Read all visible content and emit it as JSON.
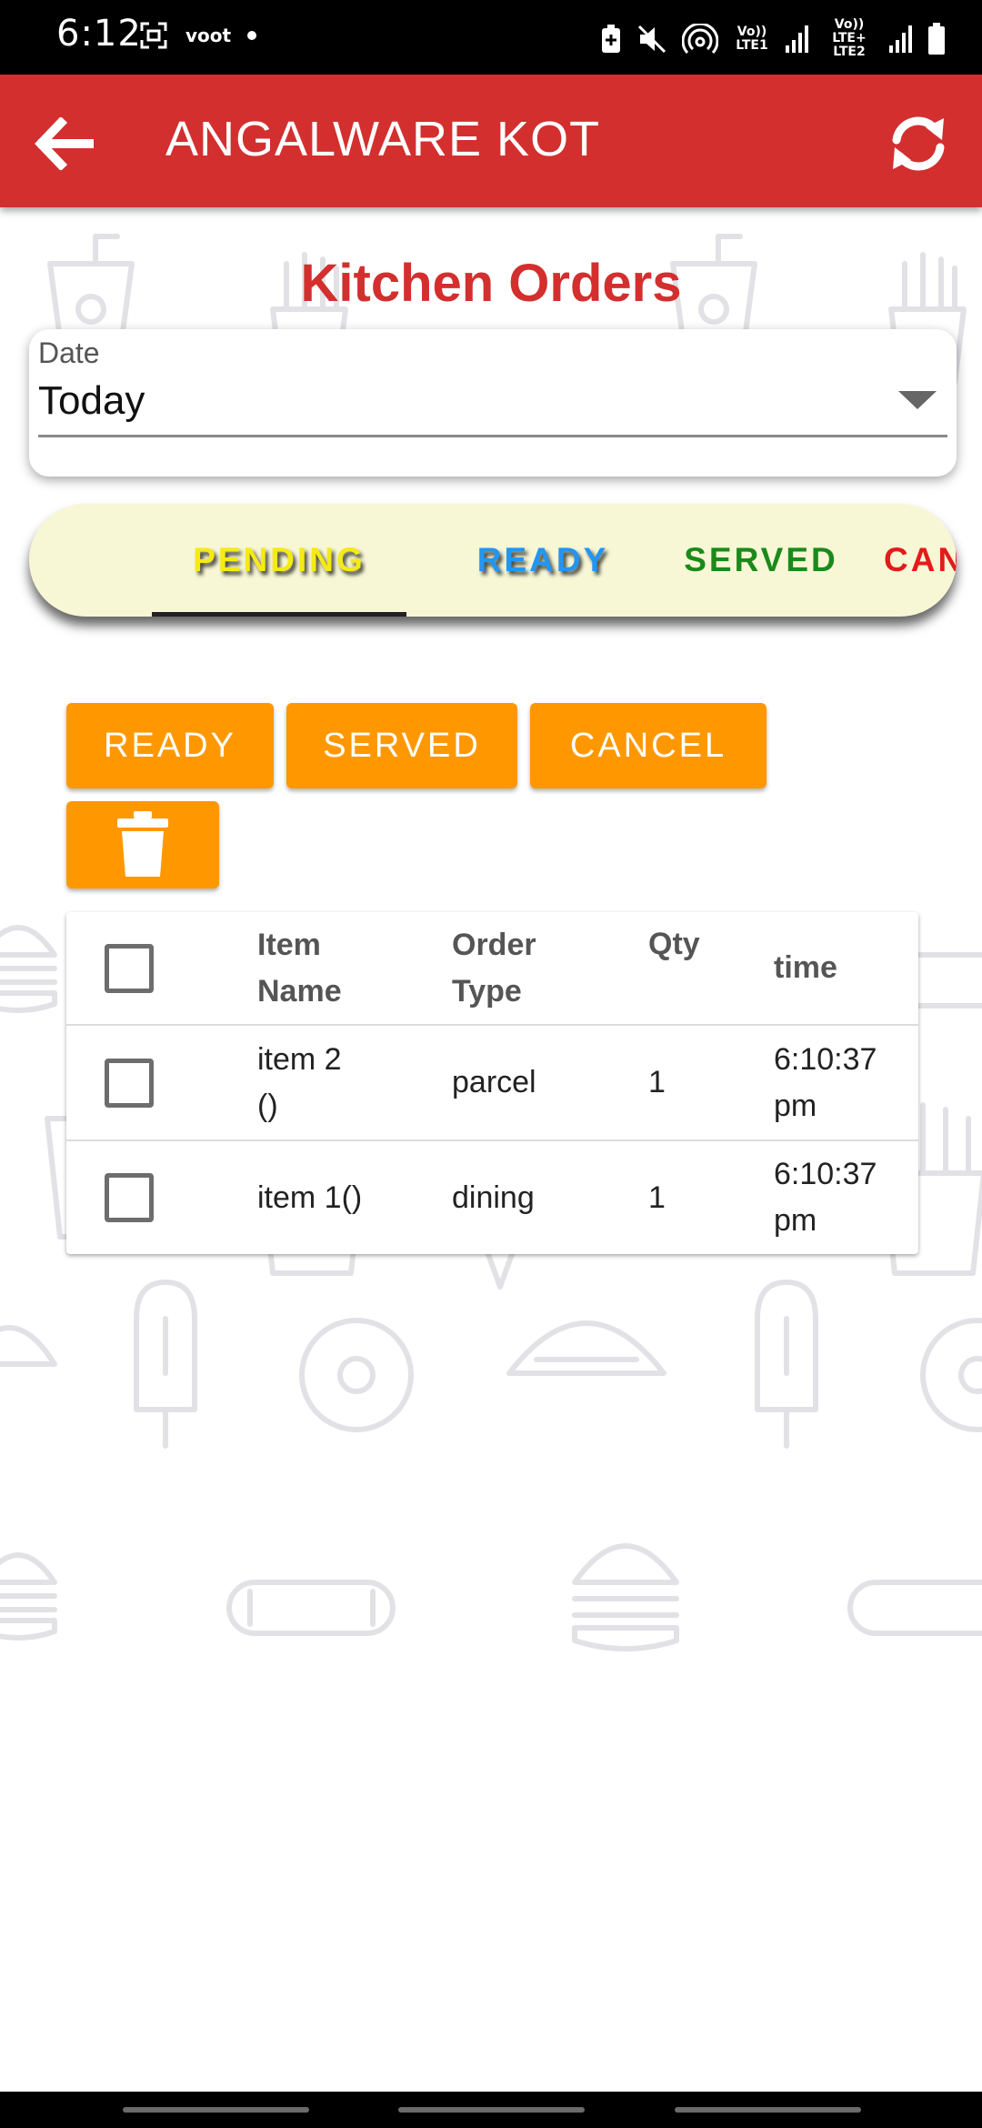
{
  "status_bar": {
    "time": "6:12",
    "carrier": "voot",
    "sim1_label": "Vo)) LTE1",
    "sim2_label": "Vo)) LTE+ LTE2"
  },
  "app_bar": {
    "title": "ANGALWARE KOT",
    "back_icon": "arrow-left-icon",
    "refresh_icon": "refresh-icon",
    "color": "#d32f2f"
  },
  "page": {
    "title": "Kitchen Orders"
  },
  "date_filter": {
    "label": "Date",
    "value": "Today"
  },
  "tabs": {
    "pending": "PENDING",
    "ready": "READY",
    "served": "SERVED",
    "cancel": "CAN",
    "active": "pending",
    "colors": {
      "pending": "#f5ea14",
      "ready": "#2196f3",
      "served": "#1b8a1b",
      "cancel": "#e31b1b"
    }
  },
  "actions": {
    "ready": "READY",
    "served": "SERVED",
    "cancel": "CANCEL",
    "delete_icon": "trash-icon",
    "color": "#ff9800"
  },
  "table": {
    "headers": {
      "item_name": [
        "Item",
        "Name"
      ],
      "order_type": [
        "Order",
        "Type"
      ],
      "qty": "Qty",
      "time": "time"
    },
    "rows": [
      {
        "item_name": [
          "item 2",
          "()"
        ],
        "order_type": "parcel",
        "qty": "1",
        "time": [
          "6:10:37",
          "pm"
        ]
      },
      {
        "item_name": [
          "item 1()"
        ],
        "order_type": "dining",
        "qty": "1",
        "time": [
          "6:10:37",
          "pm"
        ]
      }
    ]
  }
}
